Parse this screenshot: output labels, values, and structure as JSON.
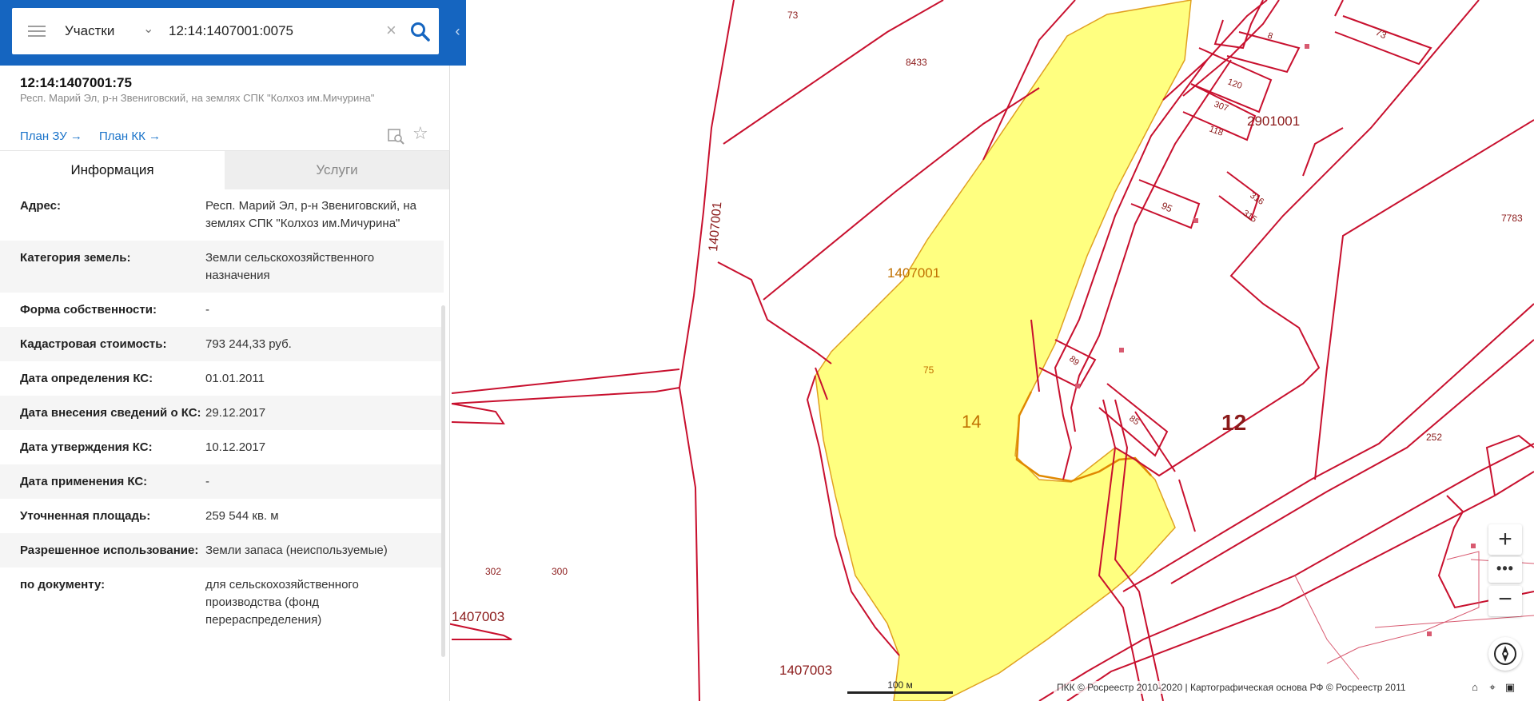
{
  "search": {
    "category": "Участки",
    "query": "12:14:1407001:0075",
    "clear_symbol": "×",
    "collapse_symbol": "‹"
  },
  "parcel": {
    "title": "12:14:1407001:75",
    "subtitle": "Респ. Марий Эл, р-н Звениговский, на землях СПК \"Колхоз им.Мичурина\"",
    "plan_zu": "План ЗУ →",
    "plan_kk": "План КК →"
  },
  "tabs": {
    "info": "Информация",
    "services": "Услуги"
  },
  "rows": [
    {
      "label": "Адрес:",
      "value": "Респ. Марий Эл, р-н Звениговский, на землях СПК \"Колхоз им.Мичурина\""
    },
    {
      "label": "Категория земель:",
      "value": "Земли сельскохозяйственного назначения"
    },
    {
      "label": "Форма собственности:",
      "value": "-"
    },
    {
      "label": "Кадастровая стоимость:",
      "value": "793 244,33 руб."
    },
    {
      "label": "Дата определения КС:",
      "value": "01.01.2011"
    },
    {
      "label": "Дата внесения сведений о КС:",
      "value": "29.12.2017"
    },
    {
      "label": "Дата утверждения КС:",
      "value": "10.12.2017"
    },
    {
      "label": "Дата применения КС:",
      "value": "-"
    },
    {
      "label": "Уточненная площадь:",
      "value": "259 544 кв. м"
    },
    {
      "label": "Разрешенное использование:",
      "value": "Земли запаса (неиспользуемые)"
    },
    {
      "label": "по документу:",
      "value": "для сельскохозяйственного производства (фонд перераспределения)"
    }
  ],
  "map": {
    "labels": {
      "l73a": "73",
      "l8433": "8433",
      "l73b": "73",
      "l8": "8",
      "l120": "120",
      "l307": "307",
      "l118": "118",
      "l2901001": "2901001",
      "l316": "316",
      "l315": "315",
      "l95": "95",
      "l7783": "7783",
      "l1407001v": "1407001",
      "l1407001": "1407001",
      "l75": "75",
      "l89": "89",
      "l85": "85",
      "l14": "14",
      "l12": "12",
      "l252": "252",
      "l302": "302",
      "l300": "300",
      "l1407003a": "1407003",
      "l1407003b": "1407003"
    },
    "scale": "100 м",
    "attribution": "ПКК © Росреестр 2010-2020 | Картографическая основа РФ © Росреестр 2011",
    "controls": {
      "zoom_in": "+",
      "more": "•••",
      "zoom_out": "−"
    },
    "colors": {
      "boundary": "#c8102e",
      "parcel_fill": "#ffff80",
      "parcel_stroke": "#e0a020",
      "panel_accent": "#1565c0"
    }
  }
}
